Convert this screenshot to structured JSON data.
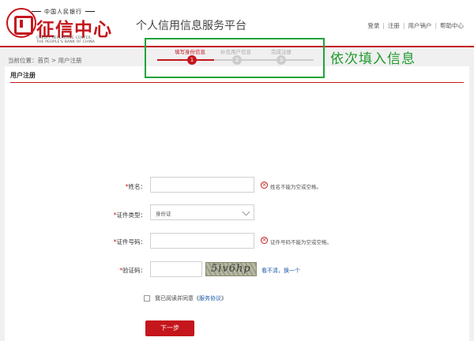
{
  "header": {
    "logo_top": "中国人民银行",
    "logo_main": "征信中心",
    "logo_en_1": "CREDIT REFERENCE CENTER,",
    "logo_en_2": "THE PEOPLE'S BANK OF CHINA",
    "site_title": "个人信用信息服务平台",
    "links": [
      "登录",
      "注册",
      "用户销户",
      "帮助中心"
    ],
    "separator": "|"
  },
  "breadcrumb": "当前位置：首页 > 用户注册",
  "panel": {
    "title": "用户注册"
  },
  "steps": [
    {
      "num": "1",
      "label": "填写身份信息",
      "active": true
    },
    {
      "num": "2",
      "label": "补充用户信息",
      "active": false
    },
    {
      "num": "3",
      "label": "完成注册",
      "active": false
    }
  ],
  "hint": "依次填入信息",
  "form": {
    "required_mark": "*",
    "name_label": "姓名：",
    "name_value": "",
    "name_error": "姓名不能为空或空格。",
    "id_type_label": "证件类型：",
    "id_type_value": "身份证",
    "id_number_label": "证件号码：",
    "id_number_value": "",
    "id_number_error": "证件号码不能为空或空格。",
    "captcha_label": "验证码：",
    "captcha_value": "",
    "captcha_text": "5iv6hp",
    "refresh_text": "看不清，换一个",
    "error_icon": "×",
    "agree_text": "我已阅读并同意《",
    "agree_link": "服务协议",
    "agree_end": "》",
    "agree_checked": false,
    "submit_label": "下一步"
  },
  "colors": {
    "brand": "#c4161c",
    "hint": "#1f9a2c",
    "link": "#1e5aa8"
  }
}
